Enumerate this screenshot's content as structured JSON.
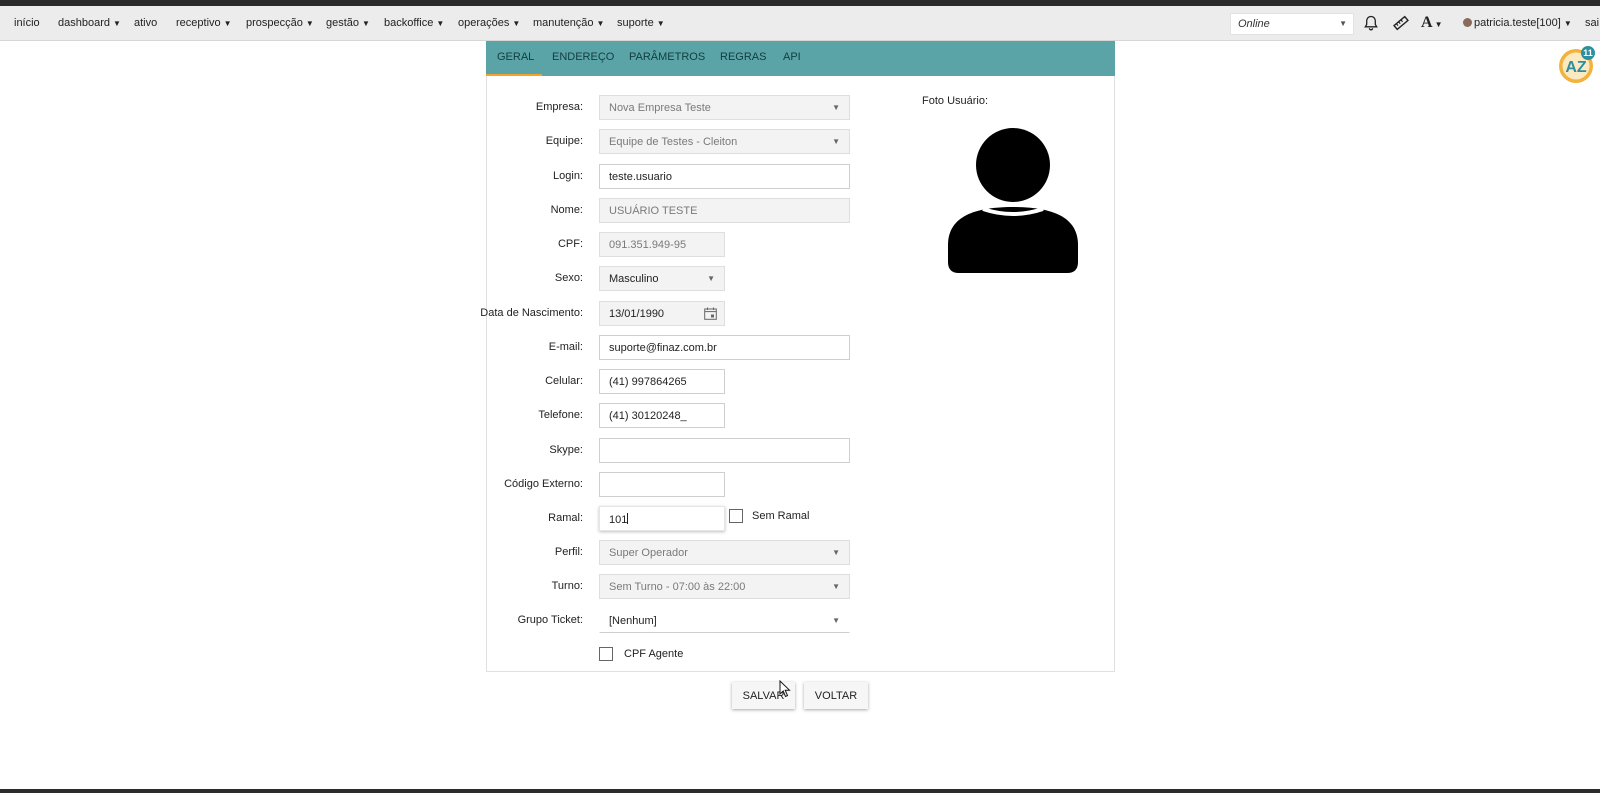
{
  "navbar": {
    "items": [
      {
        "label": "início",
        "has_caret": false
      },
      {
        "label": "dashboard",
        "has_caret": true
      },
      {
        "label": "ativo",
        "has_caret": false
      },
      {
        "label": "receptivo",
        "has_caret": true
      },
      {
        "label": "prospecção",
        "has_caret": true
      },
      {
        "label": "gestão",
        "has_caret": true
      },
      {
        "label": "backoffice",
        "has_caret": true
      },
      {
        "label": "operações",
        "has_caret": true
      },
      {
        "label": "manutenção",
        "has_caret": true
      },
      {
        "label": "suporte",
        "has_caret": true
      }
    ],
    "status": "Online",
    "icons": [
      "bell-icon",
      "pencil-ruler-icon",
      "font-size-icon"
    ],
    "user": "patricia.teste[100]",
    "logout": "sai"
  },
  "badge": {
    "text": "AZ",
    "count": "11"
  },
  "tabs": [
    {
      "label": "GERAL",
      "active": true
    },
    {
      "label": "ENDEREÇO",
      "active": false
    },
    {
      "label": "PARÂMETROS",
      "active": false
    },
    {
      "label": "REGRAS",
      "active": false
    },
    {
      "label": "API",
      "active": false
    }
  ],
  "form": {
    "empresa": {
      "label": "Empresa:",
      "value": "Nova Empresa Teste"
    },
    "equipe": {
      "label": "Equipe:",
      "value": "Equipe de Testes - Cleiton"
    },
    "login": {
      "label": "Login:",
      "value": "teste.usuario"
    },
    "nome": {
      "label": "Nome:",
      "value": "USUÁRIO TESTE"
    },
    "cpf": {
      "label": "CPF:",
      "value": "091.351.949-95"
    },
    "sexo": {
      "label": "Sexo:",
      "value": "Masculino"
    },
    "nascimento": {
      "label": "Data de Nascimento:",
      "value": "13/01/1990"
    },
    "email": {
      "label": "E-mail:",
      "value": "suporte@finaz.com.br"
    },
    "celular": {
      "label": "Celular:",
      "value": "(41) 997864265"
    },
    "telefone": {
      "label": "Telefone:",
      "value": "(41) 30120248_"
    },
    "skype": {
      "label": "Skype:",
      "value": ""
    },
    "codigo_externo": {
      "label": "Código Externo:",
      "value": ""
    },
    "ramal": {
      "label": "Ramal:",
      "value": "101"
    },
    "sem_ramal": {
      "label": "Sem Ramal",
      "checked": false
    },
    "perfil": {
      "label": "Perfil:",
      "value": "Super Operador"
    },
    "turno": {
      "label": "Turno:",
      "value": "Sem Turno - 07:00 às 22:00"
    },
    "grupo_ticket": {
      "label": "Grupo Ticket:",
      "value": "[Nenhum]"
    },
    "cpf_agente": {
      "label": "CPF Agente",
      "checked": false
    }
  },
  "photo": {
    "label": "Foto Usuário:"
  },
  "buttons": {
    "save": "SALVAR",
    "back": "VOLTAR"
  },
  "colors": {
    "tab_bar": "#5aa4a8",
    "active_tab_underline": "#f2a32a",
    "badge": "#f2b33d",
    "badge_count": "#2d8fa0"
  }
}
